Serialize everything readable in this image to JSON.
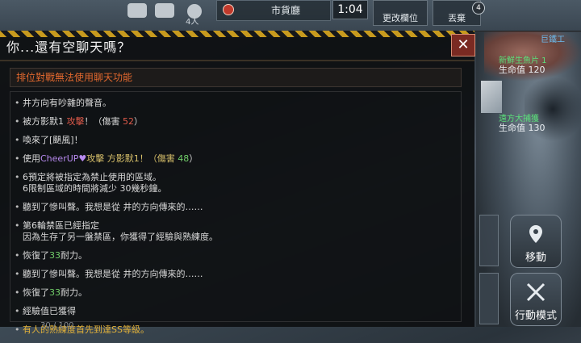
{
  "topbar": {
    "player_count": "4人",
    "location": "市貨廳",
    "timer": "1:04",
    "rank_button": "更改欄位",
    "exit_button": "丟棄",
    "badge_count": "4"
  },
  "side": {
    "npc1_name": "巨鐵工",
    "npc2_name": "新鮮生魚片 1",
    "npc2_hp": "生命值 120",
    "npc3_name": "遠方大捕獲",
    "npc3_hp": "生命值 130",
    "move_button": "移動",
    "action_button": "行動模式"
  },
  "chat": {
    "title": "你...還有空聊天嗎？",
    "close": "✕",
    "notice": "排位對戰無法使用聊天功能",
    "lines": [
      {
        "a": "井方向有吵雜的聲音。"
      },
      {
        "a": "被方影默1 ",
        "b": "攻擊",
        "c": "！（傷害 ",
        "d": "52",
        "e": "）"
      },
      {
        "a": "喚來了[颶風]！"
      },
      {
        "a": "使用",
        "b": "CheerUP",
        "c": "♥",
        "d": "攻擊 方影默1！（傷害 ",
        "e": "48",
        "f": "）"
      },
      {
        "a": "6預定將被指定為禁止使用的區域。",
        "b": "6限制區域的時間將減少 30幾秒鐘。"
      },
      {
        "a": "聽到了慘叫聲。我想是從 井的方向傳來的……"
      },
      {
        "a": "第6輪禁區已經指定",
        "b": "因為生存了另一盤禁區，你獲得了經驗與熟練度。"
      },
      {
        "a": "恢復了",
        "b": "33",
        "c": "耐力。"
      },
      {
        "a": "聽到了慘叫聲。我想是從 井的方向傳來的……"
      },
      {
        "a": "恢復了",
        "b": "33",
        "c": "耐力。"
      },
      {
        "a": "經驗值已獲得"
      },
      {
        "a": "有人的熟練度首先到達SS等級。"
      }
    ],
    "bottom": "30 / 100"
  }
}
